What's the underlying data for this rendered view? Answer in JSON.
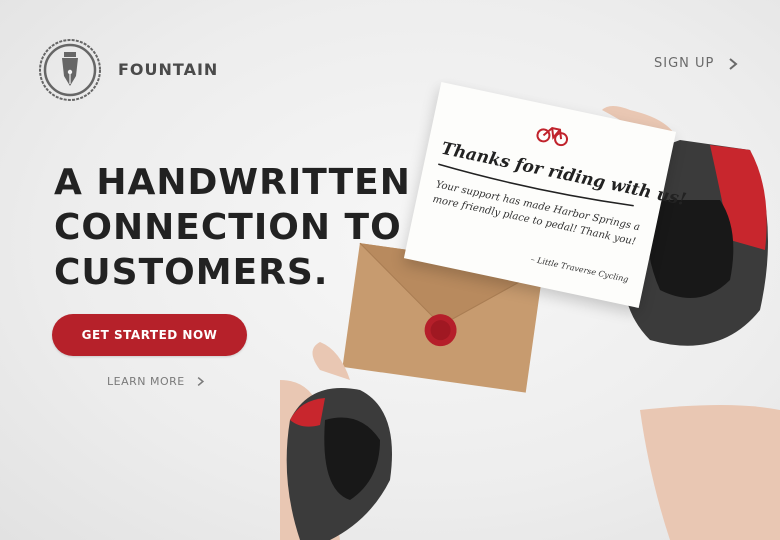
{
  "header": {
    "brand": "FOUNTAIN",
    "signup_label": "SIGN UP"
  },
  "hero": {
    "headline_lines": [
      "A HANDWRITTEN",
      "CONNECTION TO",
      "CUSTOMERS."
    ],
    "cta_label": "GET STARTED NOW",
    "learn_more_label": "LEARN MORE"
  },
  "card": {
    "title": "Thanks for riding with us!",
    "body": "Your support has made Harbor Springs a more friendly place to pedal! Thank you!",
    "signature": "– Little Traverse Cycling"
  },
  "colors": {
    "accent": "#b6212a",
    "text_dark": "#222222",
    "text_muted": "#6a6a6a"
  },
  "icons": {
    "logo": "fountain-pen-nib-icon",
    "signup": "chevron-right-icon",
    "learn_more": "chevron-right-icon",
    "card": "bicycle-icon"
  }
}
